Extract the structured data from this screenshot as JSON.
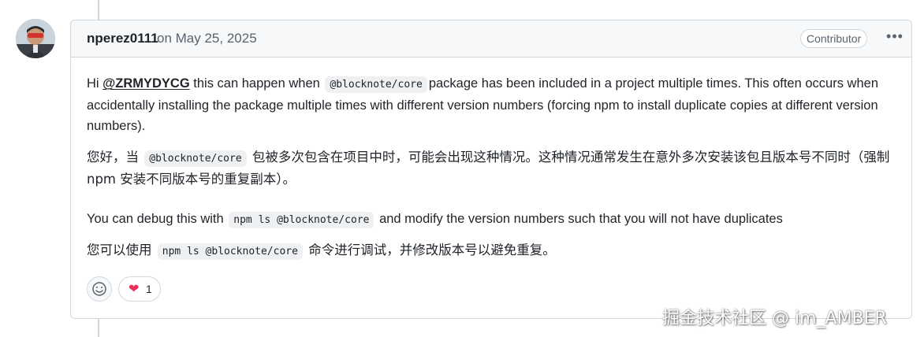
{
  "comment": {
    "author": "nperez0111",
    "date": "on May 25, 2025",
    "role_badge": "Contributor",
    "more_label": "•••"
  },
  "body": {
    "p1_part1": "Hi ",
    "mention": "@ZRMYDYCG",
    "p1_part2": " this can happen when",
    "code1": "@blocknote/core",
    "p1_part3": "package has been included in a project multiple times. This often occurs when accidentally installing the package multiple times with different version numbers (forcing npm to install duplicate copies at different version numbers).",
    "zh1_part1": "您好，当",
    "code2": "@blocknote/core",
    "zh1_part2": "包被多次包含在项目中时，可能会出现这种情况。这种情况通常发生在意外多次安装该包且版本号不同时（强制 npm 安装不同版本号的重复副本）。",
    "p2_part1": "You can debug this with",
    "code3": "npm ls @blocknote/core",
    "p2_part2": "and modify the version numbers such that you will not have duplicates",
    "zh2_part1": "您可以使用",
    "code4": "npm ls @blocknote/core",
    "zh2_part2": "命令进行调试，并修改版本号以避免重复。"
  },
  "reactions": {
    "emoji_icon": "smiley-icon",
    "heart_icon": "heart-icon",
    "heart_glyph": "❤",
    "heart_count": "1",
    "heart_color": "#e6325a"
  },
  "watermark": "掘金技术社区 @ im_AMBER"
}
